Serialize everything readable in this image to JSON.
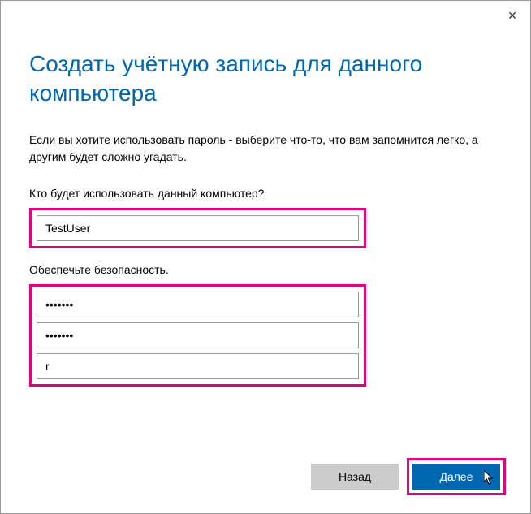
{
  "close_icon": "✕",
  "title": "Создать учётную запись для данного компьютера",
  "description": "Если вы хотите использовать пароль - выберите что-то, что вам запомнится легко, а другим будет сложно угадать.",
  "username_section": {
    "label": "Кто будет использовать данный компьютер?",
    "value": "TestUser"
  },
  "password_section": {
    "label": "Обеспечьте безопасность.",
    "password_value": "•••••••",
    "password_confirm_value": "•••••••",
    "hint_value": "r"
  },
  "buttons": {
    "back": "Назад",
    "next": "Далее"
  },
  "colors": {
    "accent": "#0067b0",
    "highlight": "#e6007e",
    "button_secondary": "#cccccc"
  }
}
